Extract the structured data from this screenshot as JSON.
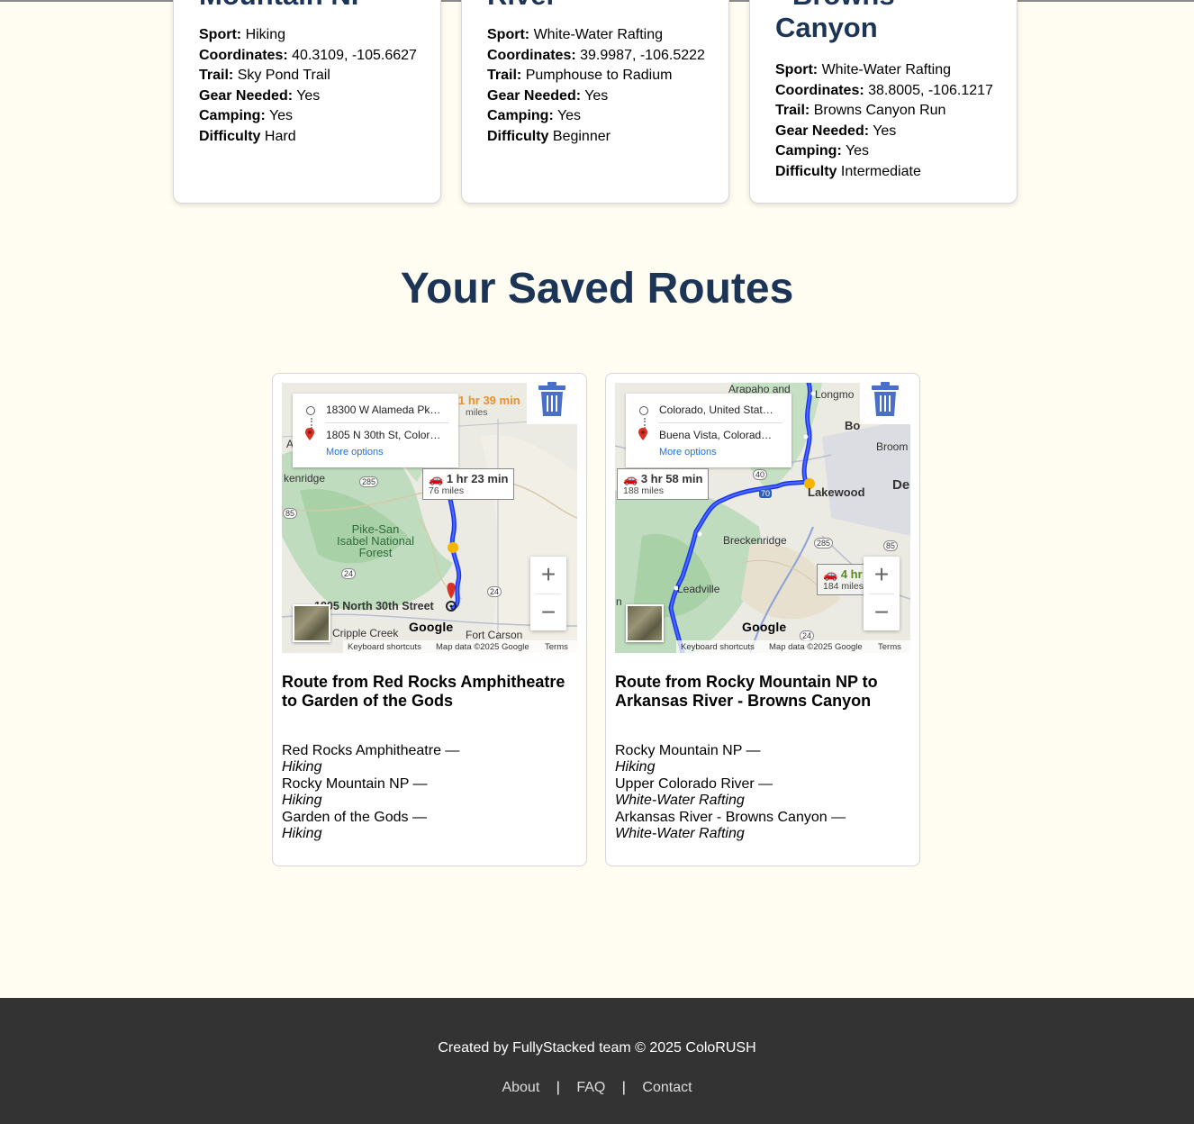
{
  "location_cards": [
    {
      "title": "Mountain NP",
      "fields": [
        {
          "label": "Sport:",
          "value": "Hiking"
        },
        {
          "label": "Coordinates:",
          "value": "40.3109, -105.6627"
        },
        {
          "label": "Trail:",
          "value": "Sky Pond Trail"
        },
        {
          "label": "Gear Needed:",
          "value": "Yes"
        },
        {
          "label": "Camping:",
          "value": "Yes"
        },
        {
          "label": "Difficulty",
          "value": "Hard"
        }
      ]
    },
    {
      "title": "River",
      "fields": [
        {
          "label": "Sport:",
          "value": "White-Water Rafting"
        },
        {
          "label": "Coordinates:",
          "value": "39.9987, -106.5222"
        },
        {
          "label": "Trail:",
          "value": "Pumphouse to Radium"
        },
        {
          "label": "Gear Needed:",
          "value": "Yes"
        },
        {
          "label": "Camping:",
          "value": "Yes"
        },
        {
          "label": "Difficulty",
          "value": "Beginner"
        }
      ]
    },
    {
      "title_line1": "- Browns",
      "title_line2": "Canyon",
      "fields": [
        {
          "label": "Sport:",
          "value": "White-Water Rafting"
        },
        {
          "label": "Coordinates:",
          "value": "38.8005, -106.1217"
        },
        {
          "label": "Trail:",
          "value": "Browns Canyon Run"
        },
        {
          "label": "Gear Needed:",
          "value": "Yes"
        },
        {
          "label": "Camping:",
          "value": "Yes"
        },
        {
          "label": "Difficulty",
          "value": "Intermediate"
        }
      ]
    }
  ],
  "section_title": "Your Saved Routes",
  "routes": [
    {
      "origin": "18300 W Alameda Pk…",
      "destination": "1805 N 30th St, Color…",
      "more_options": "More options",
      "alt_time": "1 hr 39 min",
      "alt_miles": "miles",
      "time": "1 hr 23 min",
      "miles": "76 miles",
      "labels": {
        "kenridge": "kenridge",
        "forest": "Pike-San\nIsabel National\nForest",
        "street": "1805 North 30th Street",
        "cripple": "Cripple Creek",
        "fortcarson": "Fort Carson",
        "a": "A"
      },
      "shields": [
        "285",
        "85",
        "24",
        "24"
      ],
      "title": "Route from Red Rocks Amphitheatre to Garden of the Gods",
      "stops": [
        {
          "name": "Red Rocks Amphitheatre —",
          "sport": "Hiking"
        },
        {
          "name": "Rocky Mountain NP —",
          "sport": "Hiking"
        },
        {
          "name": "Garden of the Gods —",
          "sport": "Hiking"
        }
      ]
    },
    {
      "origin": "Colorado, United Stat…",
      "destination": "Buena Vista, Colorad…",
      "more_options": "More options",
      "alt_time": "4 hr",
      "alt_miles": "184 miles",
      "time": "3 hr 58 min",
      "miles": "188 miles",
      "labels": {
        "arapaho": "Arapaho and",
        "longmont": "Longmo",
        "boulder": "Bo",
        "broom": "Broom",
        "lakewood": "Lakewood",
        "denver": "De",
        "breckenridge": "Breckenridge",
        "leadville": "Leadville",
        "n": "n"
      },
      "shields": [
        "40",
        "70",
        "285",
        "85",
        "24"
      ],
      "title": "Route from Rocky Mountain NP to Arkansas River - Browns Canyon",
      "stops": [
        {
          "name": "Rocky Mountain NP —",
          "sport": "Hiking"
        },
        {
          "name": "Upper Colorado River —",
          "sport": "White-Water Rafting"
        },
        {
          "name": "Arkansas River - Browns Canyon —",
          "sport": "White-Water Rafting"
        }
      ]
    }
  ],
  "map_footer": {
    "keyboard": "Keyboard shortcuts",
    "mapdata": "Map data ©2025 Google",
    "terms": "Terms",
    "logo": "Google"
  },
  "map_zoom": {
    "plus": "+",
    "minus": "−"
  },
  "footer": {
    "credit": "Created by FullyStacked team © 2025 ColoRUSH",
    "links": [
      "About",
      "FAQ",
      "Contact"
    ],
    "separator": "|"
  },
  "colors": {
    "heading": "#1c3557",
    "route_line": "#1a35f0",
    "trash": "#4a6fc9",
    "footer_bg": "#333333",
    "page_bg": "#fffcf2"
  }
}
